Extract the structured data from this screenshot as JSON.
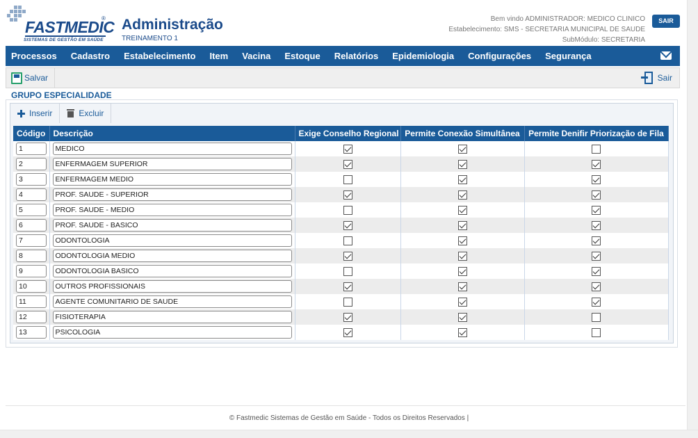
{
  "app": {
    "logo_text": "FASTMEDIC",
    "logo_tagline": "SISTEMAS DE GESTÃO EM SAÚDE",
    "logo_reg": "®",
    "title": "Administração",
    "subtitle": "TREINAMENTO 1"
  },
  "user": {
    "welcome": "Bem vindo ADMINISTRADOR: MEDICO CLINICO",
    "establishment": "Estabelecimento: SMS - SECRETARIA MUNICIPAL DE SAUDE",
    "submodule": "SubMódulo: SECRETARIA",
    "logout_label": "SAIR"
  },
  "menu": [
    "Processos",
    "Cadastro",
    "Estabelecimento",
    "Item",
    "Vacina",
    "Estoque",
    "Relatórios",
    "Epidemiologia",
    "Configurações",
    "Segurança"
  ],
  "toolbar": {
    "save_label": "Salvar",
    "exit_label": "Sair"
  },
  "section": {
    "title": "GRUPO ESPECIALIDADE",
    "insert_label": "Inserir",
    "delete_label": "Excluir"
  },
  "table": {
    "columns": [
      "Código",
      "Descrição",
      "Exige Conselho Regional",
      "Permite Conexão Simultânea",
      "Permite Denifir Priorização de Fila"
    ],
    "rows": [
      {
        "code": "1",
        "desc": "MEDICO",
        "conselho": true,
        "conexao": true,
        "fila": false
      },
      {
        "code": "2",
        "desc": "ENFERMAGEM SUPERIOR",
        "conselho": true,
        "conexao": true,
        "fila": true
      },
      {
        "code": "3",
        "desc": "ENFERMAGEM MEDIO",
        "conselho": false,
        "conexao": true,
        "fila": true
      },
      {
        "code": "4",
        "desc": "PROF. SAUDE - SUPERIOR",
        "conselho": true,
        "conexao": true,
        "fila": true
      },
      {
        "code": "5",
        "desc": "PROF. SAUDE - MEDIO",
        "conselho": false,
        "conexao": true,
        "fila": true
      },
      {
        "code": "6",
        "desc": "PROF. SAUDE - BASICO",
        "conselho": true,
        "conexao": true,
        "fila": true
      },
      {
        "code": "7",
        "desc": "ODONTOLOGIA",
        "conselho": false,
        "conexao": true,
        "fila": true
      },
      {
        "code": "8",
        "desc": "ODONTOLOGIA MEDIO",
        "conselho": true,
        "conexao": true,
        "fila": true
      },
      {
        "code": "9",
        "desc": "ODONTOLOGIA BASICO",
        "conselho": false,
        "conexao": true,
        "fila": true
      },
      {
        "code": "10",
        "desc": "OUTROS PROFISSIONAIS",
        "conselho": true,
        "conexao": true,
        "fila": true
      },
      {
        "code": "11",
        "desc": "AGENTE COMUNITARIO DE SAUDE",
        "conselho": false,
        "conexao": true,
        "fila": true
      },
      {
        "code": "12",
        "desc": "FISIOTERAPIA",
        "conselho": true,
        "conexao": true,
        "fila": false
      },
      {
        "code": "13",
        "desc": "PSICOLOGIA",
        "conselho": true,
        "conexao": true,
        "fila": false
      }
    ]
  },
  "footer": {
    "text": "© Fastmedic Sistemas de Gestão em Saúde - Todos os Direitos Reservados |"
  },
  "icons": {
    "save": "save-icon",
    "exit": "exit-icon",
    "insert": "plus-icon",
    "delete": "trash-icon",
    "mail": "mail-icon"
  },
  "colors": {
    "primary": "#1a5b99",
    "brand": "#1a4a8a",
    "row_alt": "#ececec"
  }
}
